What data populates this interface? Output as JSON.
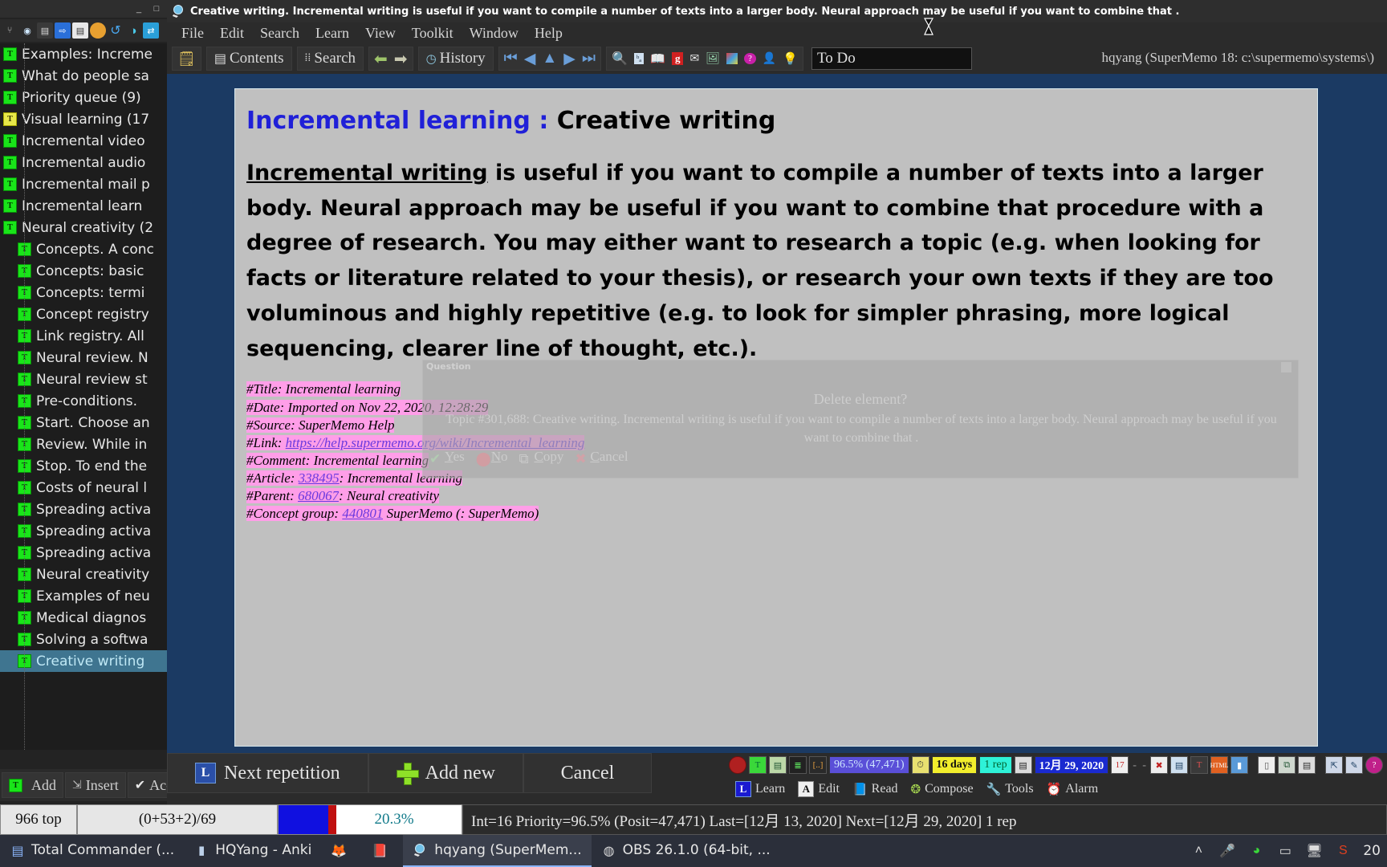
{
  "anki_window": {
    "title_buttons": [
      "_",
      "□",
      "✕"
    ],
    "toolbar_icons": [
      "stats-icon",
      "eye-icon",
      "card-icon",
      "export-icon",
      "save-icon",
      "deck-icon",
      "undo-icon",
      "info-icon",
      "sync-icon"
    ],
    "tree_items": [
      {
        "label": "Examples: Increme",
        "level": 0,
        "color": "green",
        "selected": false
      },
      {
        "label": "What do people sa",
        "level": 0,
        "color": "green",
        "selected": false
      },
      {
        "label": "Priority queue (9)",
        "level": 0,
        "color": "green",
        "selected": false
      },
      {
        "label": "Visual learning (17",
        "level": 0,
        "color": "yellow",
        "selected": false
      },
      {
        "label": "Incremental video",
        "level": 0,
        "color": "green",
        "selected": false
      },
      {
        "label": "Incremental audio",
        "level": 0,
        "color": "green",
        "selected": false
      },
      {
        "label": "Incremental mail p",
        "level": 0,
        "color": "green",
        "selected": false
      },
      {
        "label": "Incremental learn",
        "level": 0,
        "color": "green",
        "selected": false
      },
      {
        "label": "Neural creativity (2",
        "level": 0,
        "color": "green",
        "selected": false
      },
      {
        "label": "Concepts. A conc",
        "level": 1,
        "color": "green",
        "selected": false
      },
      {
        "label": "Concepts: basic",
        "level": 1,
        "color": "green",
        "selected": false
      },
      {
        "label": "Concepts: termi",
        "level": 1,
        "color": "green",
        "selected": false
      },
      {
        "label": "Concept registry",
        "level": 1,
        "color": "green",
        "selected": false
      },
      {
        "label": "Link registry. All",
        "level": 1,
        "color": "green",
        "selected": false
      },
      {
        "label": "Neural review. N",
        "level": 1,
        "color": "green",
        "selected": false
      },
      {
        "label": "Neural review st",
        "level": 1,
        "color": "green",
        "selected": false
      },
      {
        "label": "Pre-conditions. ",
        "level": 1,
        "color": "green",
        "selected": false
      },
      {
        "label": "Start. Choose an",
        "level": 1,
        "color": "green",
        "selected": false
      },
      {
        "label": "Review. While in",
        "level": 1,
        "color": "green",
        "selected": false
      },
      {
        "label": "Stop. To end the",
        "level": 1,
        "color": "green",
        "selected": false
      },
      {
        "label": "Costs of neural l",
        "level": 1,
        "color": "green",
        "selected": false
      },
      {
        "label": "Spreading activa",
        "level": 1,
        "color": "green",
        "selected": false
      },
      {
        "label": "Spreading activa",
        "level": 1,
        "color": "green",
        "selected": false
      },
      {
        "label": "Spreading activa",
        "level": 1,
        "color": "green",
        "selected": false
      },
      {
        "label": "Neural creativity",
        "level": 1,
        "color": "green",
        "selected": false
      },
      {
        "label": "Examples of neu",
        "level": 1,
        "color": "green",
        "selected": false
      },
      {
        "label": "Medical diagnos",
        "level": 1,
        "color": "green",
        "selected": false
      },
      {
        "label": "Solving a softwa",
        "level": 1,
        "color": "green",
        "selected": false
      },
      {
        "label": "Creative writing",
        "level": 1,
        "color": "green",
        "selected": true
      }
    ],
    "bottom_buttons": [
      {
        "label": "Add",
        "icon": "text-icon"
      },
      {
        "label": "Insert",
        "icon": "insert-icon"
      },
      {
        "label": "Accept",
        "icon": "check-icon"
      }
    ]
  },
  "supermemo": {
    "title": "Creative writing. Incremental writing is useful if you want to compile a number of texts into a larger body. Neural approach may be useful if you want to combine that .",
    "menu": [
      "File",
      "Edit",
      "Search",
      "Learn",
      "View",
      "Toolkit",
      "Window",
      "Help"
    ],
    "toolbar": {
      "new_label": "",
      "contents_label": "Contents",
      "search_label": "Search",
      "history_label": "History",
      "nav_first": "⏮",
      "nav_prev": "◀",
      "nav_up": "▲",
      "nav_next": "▶",
      "nav_last": "⏭",
      "icons": [
        "magnifier-icon",
        "translate-icon",
        "dictionary-icon",
        "google-icon",
        "mail-icon",
        "image-icon",
        "color-icon",
        "help-icon",
        "person-icon",
        "idea-icon"
      ]
    },
    "todo_value": "To Do",
    "system_info": "hqyang (SuperMemo 18: c:\\supermemo\\systems\\)",
    "document": {
      "heading_prefix": "Incremental learning",
      "heading_sep": " : ",
      "heading_title": "Creative writing",
      "lead_underlined": "Incremental writing",
      "body": " is useful if you want to compile a number of texts into a larger body. Neural approach may be useful if you want to combine that procedure with a degree of research. You may either want to research a topic (e.g. when looking for facts or literature related to your thesis), or research your own texts if they are too voluminous and highly repetitive (e.g. to look for simpler phrasing, more logical sequencing, clearer line of thought, etc.).",
      "metadata": [
        {
          "key": "#Title:",
          "value": " Incremental learning",
          "link": null
        },
        {
          "key": "#Date:",
          "value": " Imported on Nov 22, 2020, 12:28:29",
          "link": null
        },
        {
          "key": "#Source:",
          "value": " SuperMemo Help",
          "link": null
        },
        {
          "key": "#Link:",
          "value": "",
          "link": "https://help.supermemo.org/wiki/Incremental_learning"
        },
        {
          "key": "#Comment:",
          "value": " Incremental learning",
          "link": null
        },
        {
          "key": "#Article:",
          "value": ": Incremental learning",
          "link": "338495"
        },
        {
          "key": "#Parent:",
          "value": ": Neural creativity",
          "link": "680067"
        },
        {
          "key": "#Concept group:",
          "value": " SuperMemo (",
          "link": "440801",
          "tail": ": SuperMemo)"
        }
      ]
    },
    "dialog": {
      "caption": "Question",
      "title": "Delete element?",
      "message": "Topic #301,688: Creative writing. Incremental writing is useful if you want to compile a number of texts into a larger body. Neural approach may be useful if you want to combine that .",
      "buttons": [
        {
          "label": "Yes",
          "accel": "Y",
          "icon": "check-icon"
        },
        {
          "label": "No",
          "accel": "N",
          "icon": "circle-icon"
        },
        {
          "label": "Copy",
          "accel": "C",
          "icon": "copy-icon"
        },
        {
          "label": "Cancel",
          "accel": "C",
          "icon": "cancel-icon"
        }
      ]
    },
    "action_bar": {
      "next_repetition": "Next repetition",
      "add_new": "Add new",
      "cancel": "Cancel",
      "priority": "96.5%",
      "position": "(47,471)",
      "interval": "16 days",
      "reps": "1 rep",
      "next_date": "12月 29, 2020",
      "modes": [
        {
          "label": "Learn",
          "icon": "learn-icon"
        },
        {
          "label": "Edit",
          "icon": "edit-icon"
        },
        {
          "label": "Read",
          "icon": "read-icon"
        },
        {
          "label": "Compose",
          "icon": "compose-icon"
        },
        {
          "label": "Tools",
          "icon": "tools-icon"
        },
        {
          "label": "Alarm",
          "icon": "alarm-icon"
        }
      ]
    },
    "status_bar": {
      "position_text": "966 top",
      "counts": "(0+53+2)/69",
      "progress_label": "20.3%",
      "details": "Int=16 Priority=96.5% (Posit=47,471) Last=[12月 13, 2020] Next=[12月 29, 2020] 1 rep"
    }
  },
  "taskbar": {
    "items": [
      {
        "label": "Total Commander (...",
        "icon": "commander-icon",
        "active": false
      },
      {
        "label": "HQYang - Anki",
        "icon": "anki-icon",
        "active": false
      },
      {
        "label": "",
        "icon": "firefox-icon",
        "active": false
      },
      {
        "label": "",
        "icon": "book-icon",
        "active": false
      },
      {
        "label": "hqyang (SuperMem...",
        "icon": "supermemo-icon",
        "active": true
      },
      {
        "label": "OBS 26.1.0 (64-bit, ...",
        "icon": "obs-icon",
        "active": false
      }
    ],
    "tray_icons": [
      "chevron-up-icon",
      "microphone-icon",
      "wechat-icon",
      "battery-icon",
      "network-icon",
      "snipaste-icon"
    ],
    "clock": "20"
  },
  "colors": {
    "accent_blue": "#1b3a63",
    "doc_bg": "#c0c0c0",
    "heading_blue": "#2020d8",
    "meta_pink": "#ff9ee8",
    "selected_row": "#3f7590"
  }
}
